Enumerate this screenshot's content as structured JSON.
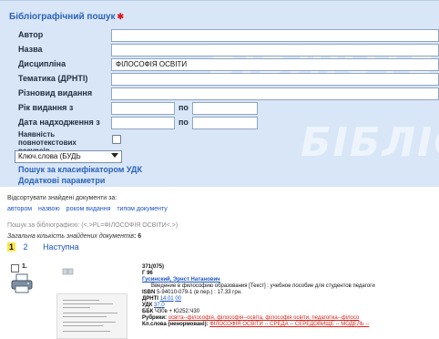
{
  "search": {
    "title": "Бібліографічний пошук",
    "fields": {
      "author": {
        "label": "Автор",
        "value": ""
      },
      "title": {
        "label": "Назва",
        "value": ""
      },
      "discipline": {
        "label": "Дисципліна",
        "value": "ФІЛОСОФІЯ ОСВІТИ"
      },
      "subject": {
        "label": "Тематика (ДРНТІ)",
        "value": ""
      },
      "edition_type": {
        "label": "Різновид видання",
        "value": ""
      },
      "year": {
        "label": "Рік видання з",
        "po": "по"
      },
      "received": {
        "label": "Дата надходження з",
        "po": "по"
      },
      "fulltext": {
        "label_line1": "Наявність",
        "label_line2": "повнотекстових",
        "label_line3": "ресурсів"
      }
    },
    "keyword_select": "Ключ.слова (БУДЬ",
    "udk_link": "Пошук за класифікатором УДК",
    "extra_link": "Додаткові параметри",
    "watermark": "БІБЛІОТЕКА"
  },
  "results": {
    "sort_label": "Відсортувати знайдені документи за:",
    "sort_options": [
      "автором",
      "назвою",
      "роком видання",
      "типом документу"
    ],
    "search_query": "Пошук за бібліографією: (<.>PL=ФІЛОСОФІЯ ОСВІТИ<.>)",
    "total_label": "Загальна кількість знайдених документів",
    "total_count": ": 6",
    "pages": [
      "1",
      "2"
    ],
    "next_label": "Наступна",
    "record": {
      "number": "1.",
      "code": "371(075)",
      "shelf": "Г 96",
      "author": "Гусинский, Эрнст Натанович",
      "desc": "Введение в философию образования [Текст] : учебное пособие для студентов педагоги",
      "isbn_label": "ISBN",
      "isbn_value": "5-94010-079-1 (в пер.) : 17.33 грн.",
      "drnti_label": "ДРНТІ",
      "drnti_value": "14.01",
      "drnti_extra": "00",
      "udk_label": "УДК",
      "udk_value": "37.0",
      "bbk_label": "ББК",
      "bbk_value": "Ч30в + Ю252:Ч30",
      "rubrics_label": "Рубрики:",
      "rubrics_value": "освіта--філософія, філософія--освіта, філософія освіти, педагогіка--філосо",
      "kw_label": "Кл.слова (ненормовані):",
      "kw_value": "ФІЛОСОФІЯ ОСВІТИ -- СРЕДА -- СЕРЕДОВИЩЕ -- МОДЕЛЬ --"
    }
  }
}
